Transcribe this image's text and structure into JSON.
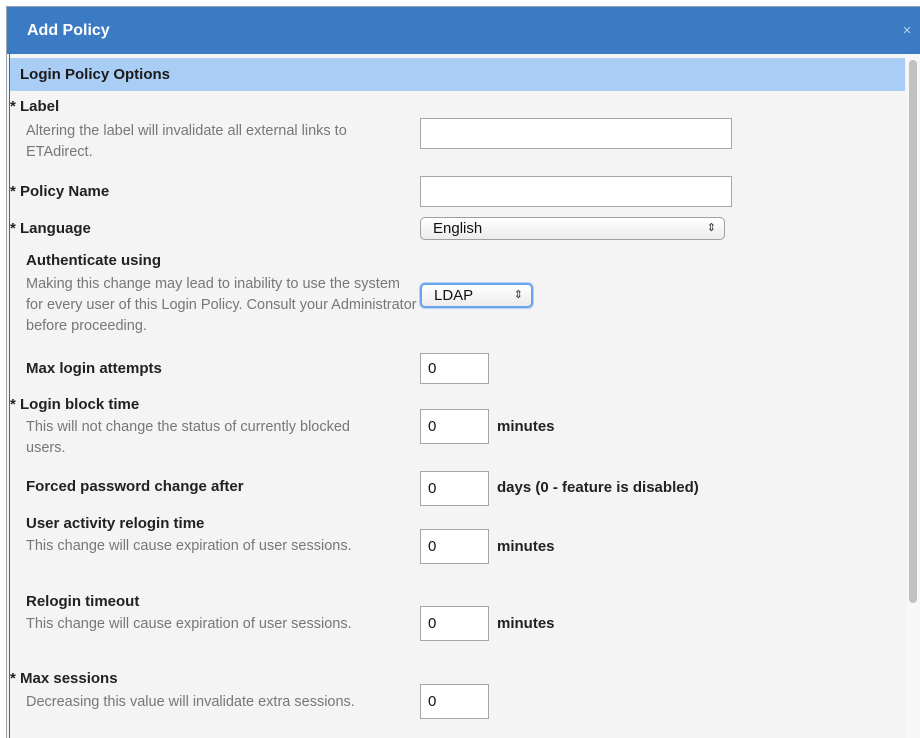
{
  "dialog": {
    "title": "Add Policy",
    "close_glyph": "×"
  },
  "section": {
    "title": "Login Policy Options"
  },
  "fields": {
    "label": {
      "required_mark": "*",
      "label": "Label",
      "help": "Altering the label will invalidate all external links to ETAdirect.",
      "value": ""
    },
    "policy_name": {
      "required_mark": "*",
      "label": "Policy Name",
      "value": ""
    },
    "language": {
      "required_mark": "*",
      "label": "Language",
      "value": "English",
      "arrows": "⇕"
    },
    "authenticate": {
      "label": "Authenticate using",
      "help": "Making this change may lead to inability to use the system for every user of this Login Policy. Consult your Administrator before proceeding.",
      "value": "LDAP",
      "arrows": "⇕"
    },
    "max_login_attempts": {
      "label": "Max login attempts",
      "value": "0"
    },
    "login_block_time": {
      "required_mark": "*",
      "label": "Login block time",
      "help": "This will not change the status of currently blocked users.",
      "value": "0",
      "unit": "minutes"
    },
    "forced_password_change": {
      "label": "Forced password change after",
      "value": "0",
      "unit": "days (0 - feature is disabled)"
    },
    "user_activity_relogin": {
      "label": "User activity relogin time",
      "help": "This change will cause expiration of user sessions.",
      "value": "0",
      "unit": "minutes"
    },
    "relogin_timeout": {
      "label": "Relogin timeout",
      "help": "This change will cause expiration of user sessions.",
      "value": "0",
      "unit": "minutes"
    },
    "max_sessions": {
      "required_mark": "*",
      "label": "Max sessions",
      "help": "Decreasing this value will invalidate extra sessions.",
      "value": "0"
    }
  },
  "colors": {
    "titlebar": "#3b7bc4",
    "section_header": "#a9cdf5",
    "focus_ring": "#6aa3ea"
  }
}
